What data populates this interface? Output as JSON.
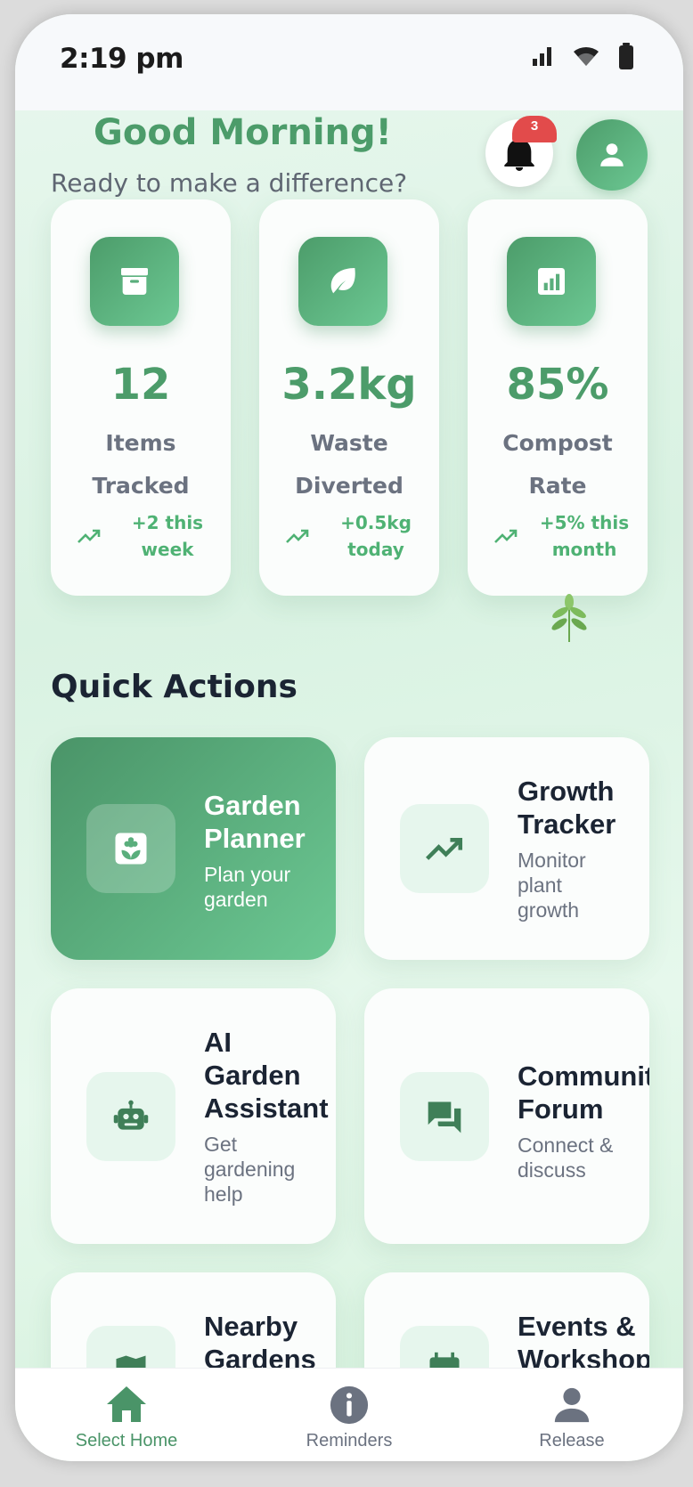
{
  "status_bar": {
    "time": "2:19 pm"
  },
  "header": {
    "greeting": "Good Morning!",
    "subtitle": "Ready to make a difference?",
    "notification_count": "3"
  },
  "stats": [
    {
      "value": "12",
      "label": "Items Tracked",
      "trend": "+2 this week",
      "icon": "archive-icon"
    },
    {
      "value": "3.2kg",
      "label": "Waste Diverted",
      "trend": "+0.5kg today",
      "icon": "leaf-icon"
    },
    {
      "value": "85%",
      "label": "Compost Rate",
      "trend": "+5% this month",
      "icon": "analytics-icon"
    }
  ],
  "quick_actions": {
    "title": "Quick Actions",
    "items": [
      {
        "title": "Garden\nPlanner",
        "desc": "Plan your\ngarden",
        "icon": "local-florist-icon"
      },
      {
        "title": "Growth\nTracker",
        "desc": "Monitor\nplant\ngrowth",
        "icon": "trending-up-icon"
      },
      {
        "title": "AI\nGarden\nAssistant",
        "desc": "Get\ngardening\nhelp",
        "icon": "robot-icon"
      },
      {
        "title": "Community\nForum",
        "desc": "Connect &\ndiscuss",
        "icon": "forum-icon"
      },
      {
        "title": "Nearby\nGardens",
        "desc": "",
        "icon": "map-icon"
      },
      {
        "title": "Events &\nWorkshops",
        "desc": "",
        "icon": "calendar-icon"
      }
    ]
  },
  "bottom_nav": [
    {
      "label": "Select Home",
      "icon": "home-icon"
    },
    {
      "label": "Reminders",
      "icon": "info-icon"
    },
    {
      "label": "Release",
      "icon": "person-icon"
    }
  ],
  "colors": {
    "accent": "#4c9c6a",
    "accent_light": "#6cc893",
    "badge": "#e24b4b",
    "text_dark": "#1b2433",
    "text_muted": "#6b7280"
  }
}
